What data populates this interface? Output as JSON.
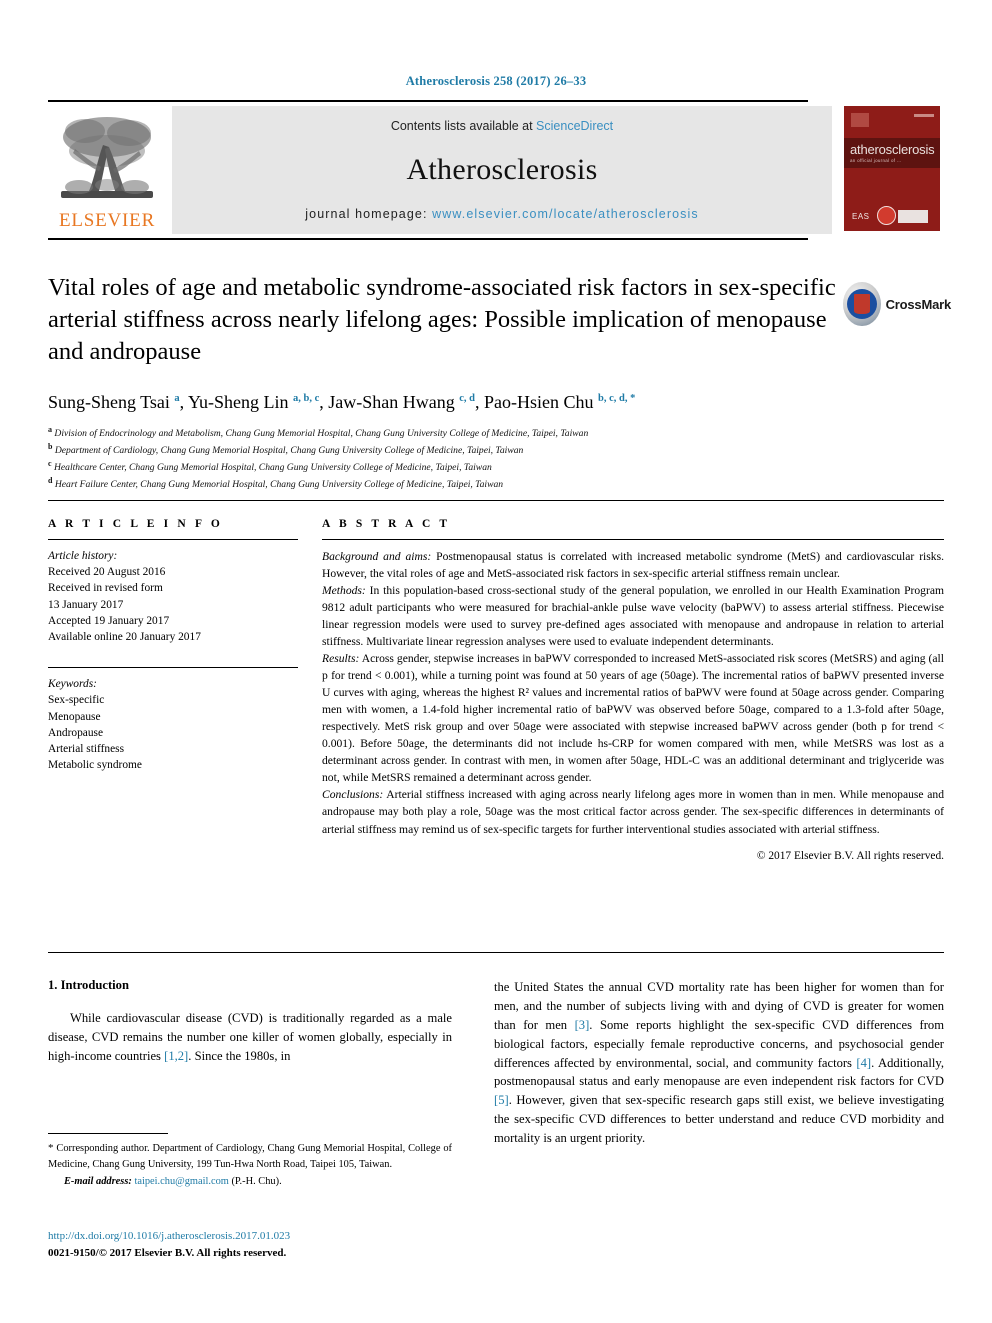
{
  "running_head": "Atherosclerosis 258 (2017) 26–33",
  "masthead": {
    "publisher_logo_name": "ELSEVIER",
    "contents_prefix": "Contents lists available at ",
    "contents_link": "ScienceDirect",
    "journal_name": "Atherosclerosis",
    "homepage_prefix": "journal homepage: ",
    "homepage_link": "www.elsevier.com/locate/atherosclerosis",
    "cover": {
      "title": "atherosclerosis",
      "subtitle": "an official journal of ...",
      "society": "EAS"
    }
  },
  "crossmark": {
    "label": "CrossMark"
  },
  "article": {
    "title": "Vital roles of age and metabolic syndrome-associated risk factors in sex-specific arterial stiffness across nearly lifelong ages: Possible implication of menopause and andropause",
    "authors_html": "Sung-Sheng Tsai <sup>a</sup>, Yu-Sheng Lin <sup>a, b, c</sup>, Jaw-Shan Hwang <sup>c, d</sup>, Pao-Hsien Chu <sup>b, c, d, *</sup>",
    "affiliations": [
      {
        "mark": "a",
        "text": "Division of Endocrinology and Metabolism, Chang Gung Memorial Hospital, Chang Gung University College of Medicine, Taipei, Taiwan"
      },
      {
        "mark": "b",
        "text": "Department of Cardiology, Chang Gung Memorial Hospital, Chang Gung University College of Medicine, Taipei, Taiwan"
      },
      {
        "mark": "c",
        "text": "Healthcare Center, Chang Gung Memorial Hospital, Chang Gung University College of Medicine, Taipei, Taiwan"
      },
      {
        "mark": "d",
        "text": "Heart Failure Center, Chang Gung Memorial Hospital, Chang Gung University College of Medicine, Taipei, Taiwan"
      }
    ]
  },
  "article_info": {
    "heading": "A R T I C L E   I N F O",
    "history_label": "Article history:",
    "history": [
      "Received 20 August 2016",
      "Received in revised form",
      "13 January 2017",
      "Accepted 19 January 2017",
      "Available online 20 January 2017"
    ],
    "keywords_label": "Keywords:",
    "keywords": [
      "Sex-specific",
      "Menopause",
      "Andropause",
      "Arterial stiffness",
      "Metabolic syndrome"
    ]
  },
  "abstract": {
    "heading": "A B S T R A C T",
    "sections": [
      {
        "label": "Background and aims:",
        "text": " Postmenopausal status is correlated with increased metabolic syndrome (MetS) and cardiovascular risks. However, the vital roles of age and MetS-associated risk factors in sex-specific arterial stiffness remain unclear."
      },
      {
        "label": "Methods:",
        "text": " In this population-based cross-sectional study of the general population, we enrolled in our Health Examination Program 9812 adult participants who were measured for brachial-ankle pulse wave velocity (baPWV) to assess arterial stiffness. Piecewise linear regression models were used to survey pre-defined ages associated with menopause and andropause in relation to arterial stiffness. Multivariate linear regression analyses were used to evaluate independent determinants."
      },
      {
        "label": "Results:",
        "text": " Across gender, stepwise increases in baPWV corresponded to increased MetS-associated risk scores (MetSRS) and aging (all p for trend < 0.001), while a turning point was found at 50 years of age (50age). The incremental ratios of baPWV presented inverse U curves with aging, whereas the highest R² values and incremental ratios of baPWV were found at 50age across gender. Comparing men with women, a 1.4-fold higher incremental ratio of baPWV was observed before 50age, compared to a 1.3-fold after 50age, respectively. MetS risk group and over 50age were associated with stepwise increased baPWV across gender (both p for trend < 0.001). Before 50age, the determinants did not include hs-CRP for women compared with men, while MetSRS was lost as a determinant across gender. In contrast with men, in women after 50age, HDL-C was an additional determinant and triglyceride was not, while MetSRS remained a determinant across gender."
      },
      {
        "label": "Conclusions:",
        "text": " Arterial stiffness increased with aging across nearly lifelong ages more in women than in men. While menopause and andropause may both play a role, 50age was the most critical factor across gender. The sex-specific differences in determinants of arterial stiffness may remind us of sex-specific targets for further interventional studies associated with arterial stiffness."
      }
    ],
    "copyright": "© 2017 Elsevier B.V. All rights reserved."
  },
  "body": {
    "section_heading": "1. Introduction",
    "left_paragraph_html": "While cardiovascular disease (CVD) is traditionally regarded as a male disease, CVD remains the number one killer of women globally, especially in high-income countries <span class=\"ref\">[1,2]</span>. Since the 1980s, in",
    "right_paragraph_html": "the United States the annual CVD mortality rate has been higher for women than for men, and the number of subjects living with and dying of CVD is greater for women than for men <span class=\"ref\">[3]</span>. Some reports highlight the sex-specific CVD differences from biological factors, especially female reproductive concerns, and psychosocial gender differences affected by environmental, social, and community factors <span class=\"ref\">[4]</span>. Additionally, postmenopausal status and early menopause are even independent risk factors for CVD <span class=\"ref\">[5]</span>. However, given that sex-specific research gaps still exist, we believe investigating the sex-specific CVD differences to better understand and reduce CVD morbidity and mortality is an urgent priority."
  },
  "footnotes": {
    "corresponding_html": "<span class=\"star\">*</span> Corresponding author. Department of Cardiology, Chang Gung Memorial Hospital, College of Medicine, Chang Gung University, 199 Tun-Hwa North Road, Taipei 105, Taiwan.",
    "email_label": "E-mail address:",
    "email": "taipei.chu@gmail.com",
    "email_suffix": " (P.-H. Chu)."
  },
  "doi": {
    "url": "http://dx.doi.org/10.1016/j.atherosclerosis.2017.01.023",
    "issn_line": "0021-9150/© 2017 Elsevier B.V. All rights reserved."
  },
  "colors": {
    "link_blue": "#1f7ba6",
    "elsevier_orange": "#E87722",
    "cover_red": "#8e1c18"
  }
}
